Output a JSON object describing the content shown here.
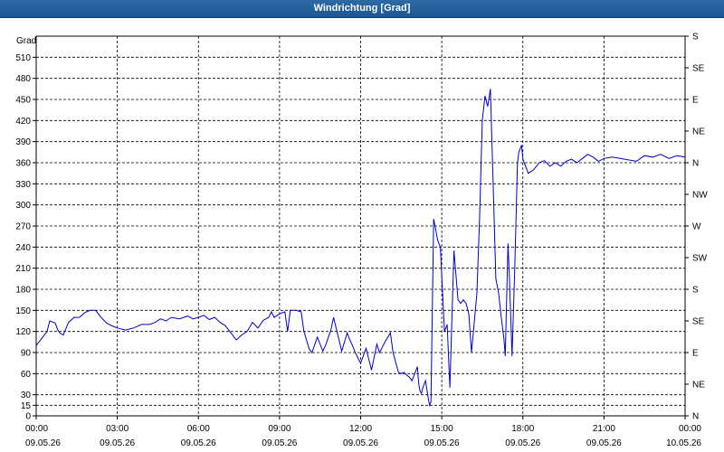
{
  "window": {
    "title": "Windrichtung [Grad]"
  },
  "chart_data": {
    "type": "line",
    "title": "Windrichtung [Grad]",
    "ylabel": "Grad",
    "ylim": [
      0,
      540
    ],
    "y_ticks": [
      0,
      15,
      30,
      60,
      90,
      120,
      150,
      180,
      210,
      240,
      270,
      300,
      330,
      360,
      390,
      420,
      450,
      480,
      510
    ],
    "y_tick_labels": [
      "0",
      "15",
      "30",
      "60",
      "90",
      "120",
      "150",
      "180",
      "210",
      "240",
      "270",
      "300",
      "330",
      "360",
      "390",
      "420",
      "450",
      "480",
      "510"
    ],
    "right_axis": {
      "ticks": [
        0,
        45,
        90,
        135,
        180,
        225,
        270,
        315,
        360,
        405,
        450,
        495,
        540
      ],
      "labels": [
        "N",
        "NE",
        "E",
        "SE",
        "S",
        "SW",
        "W",
        "NW",
        "N",
        "NE",
        "E",
        "SE",
        "S"
      ]
    },
    "xlim": [
      0,
      24
    ],
    "x_ticks": [
      0,
      3,
      6,
      9,
      12,
      15,
      18,
      21,
      24
    ],
    "x_tick_times": [
      "00:00",
      "03:00",
      "06:00",
      "09:00",
      "12:00",
      "15:00",
      "18:00",
      "21:00",
      "00:00"
    ],
    "x_tick_dates": [
      "09.05.26",
      "09.05.26",
      "09.05.26",
      "09.05.26",
      "09.05.26",
      "09.05.26",
      "09.05.26",
      "09.05.26",
      "10.05.26"
    ],
    "grid": true,
    "line_color": "#0000cc",
    "series": [
      {
        "x": [
          0,
          0.2,
          0.4,
          0.5,
          0.7,
          0.8,
          0.9,
          1.0,
          1.2,
          1.4,
          1.6,
          1.8,
          2.0,
          2.2,
          2.4,
          2.6,
          2.8,
          3.0,
          3.3,
          3.6,
          3.9,
          4.2,
          4.4,
          4.6,
          4.8,
          5.0,
          5.3,
          5.6,
          5.8,
          6.0,
          6.2,
          6.4,
          6.6,
          6.8,
          7.0,
          7.2,
          7.4,
          7.6,
          7.8,
          8.0,
          8.2,
          8.4,
          8.6,
          8.7,
          8.8,
          9.0,
          9.2,
          9.3,
          9.4,
          9.6,
          9.8,
          9.9,
          10.1,
          10.2,
          10.4,
          10.6,
          10.7,
          10.9,
          11.0,
          11.3,
          11.5,
          11.6,
          11.7,
          11.8,
          12.0,
          12.2,
          12.4,
          12.6,
          12.7,
          12.9,
          13.1,
          13.2,
          13.4,
          13.5,
          13.6,
          13.7,
          13.8,
          13.9,
          14.1,
          14.15,
          14.2,
          14.25,
          14.3,
          14.4,
          14.5,
          14.55,
          14.6,
          14.7,
          14.85,
          14.95,
          15.1,
          15.2,
          15.3,
          15.45,
          15.6,
          15.7,
          15.8,
          15.9,
          16.0,
          16.1,
          16.3,
          16.4,
          16.5,
          16.6,
          16.7,
          16.8,
          17.0,
          17.1,
          17.2,
          17.3,
          17.35,
          17.45,
          17.5,
          17.6,
          17.7,
          17.8,
          17.85,
          17.95,
          18.0,
          18.2,
          18.4,
          18.6,
          18.8,
          19.0,
          19.2,
          19.4,
          19.6,
          19.8,
          20.0,
          20.2,
          20.4,
          20.6,
          20.8,
          21.0,
          21.3,
          21.6,
          21.9,
          22.2,
          22.5,
          22.8,
          23.1,
          23.4,
          23.7,
          24.0
        ],
        "values": [
          100,
          110,
          120,
          135,
          132,
          122,
          117,
          115,
          133,
          140,
          140,
          147,
          150,
          150,
          140,
          132,
          128,
          125,
          122,
          125,
          130,
          130,
          133,
          138,
          135,
          140,
          138,
          142,
          138,
          140,
          143,
          137,
          140,
          133,
          128,
          118,
          108,
          115,
          120,
          133,
          125,
          136,
          140,
          148,
          140,
          145,
          148,
          120,
          150,
          150,
          148,
          120,
          95,
          90,
          112,
          92,
          100,
          122,
          140,
          92,
          118,
          108,
          100,
          90,
          75,
          96,
          65,
          102,
          90,
          105,
          118,
          90,
          62,
          60,
          62,
          58,
          55,
          50,
          70,
          45,
          35,
          32,
          40,
          50,
          25,
          15,
          20,
          280,
          250,
          240,
          120,
          130,
          40,
          235,
          165,
          160,
          165,
          160,
          145,
          90,
          175,
          280,
          420,
          455,
          440,
          465,
          195,
          175,
          140,
          110,
          85,
          245,
          200,
          85,
          210,
          360,
          375,
          385,
          365,
          345,
          350,
          360,
          363,
          355,
          360,
          355,
          362,
          365,
          360,
          366,
          372,
          368,
          362,
          366,
          368,
          366,
          364,
          362,
          370,
          368,
          372,
          366,
          370,
          368
        ]
      }
    ]
  }
}
